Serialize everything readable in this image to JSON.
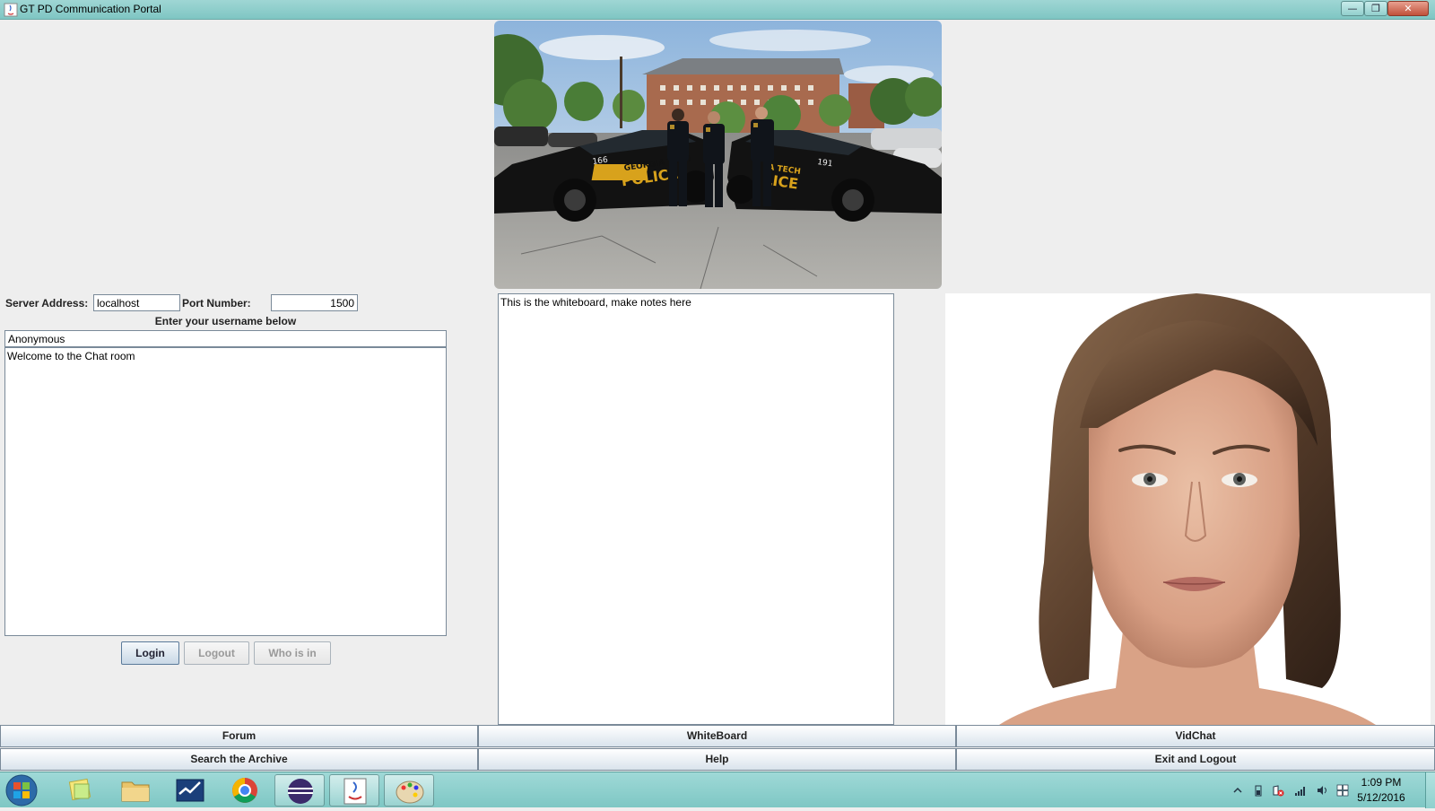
{
  "window": {
    "title": "GT PD Communication Portal",
    "controls": {
      "minimize": "—",
      "maximize": "❐",
      "close": "✕"
    }
  },
  "connection": {
    "server_label": "Server Address:",
    "server_value": "localhost",
    "port_label": "Port Number:",
    "port_value": "1500",
    "username_prompt": "Enter your username below",
    "username_value": "Anonymous"
  },
  "chat": {
    "log_text": "Welcome to the Chat room",
    "buttons": {
      "login": "Login",
      "logout": "Logout",
      "who": "Who is in"
    }
  },
  "whiteboard": {
    "text": "This is the whiteboard, make notes here"
  },
  "photo": {
    "car_left_number": "166",
    "car_right_number": "191",
    "car_left_text": "GEORGIA TECH POLICE",
    "car_right_text": "GEORGIA TECH POLICE"
  },
  "nav": {
    "row1": [
      "Forum",
      "WhiteBoard",
      "VidChat"
    ],
    "row2": [
      "Search the Archive",
      "Help",
      "Exit and Logout"
    ]
  },
  "taskbar": {
    "apps": [
      "start-orb",
      "sticky-notes-icon",
      "file-explorer-icon",
      "task-manager-icon",
      "chrome-icon",
      "eclipse-icon",
      "java-icon",
      "paint-icon"
    ],
    "time": "1:09 PM",
    "date": "5/12/2016"
  },
  "colors": {
    "titlebar": "#8fcfcc",
    "taskbar": "#8ecfcc",
    "background": "#eeeeee"
  }
}
